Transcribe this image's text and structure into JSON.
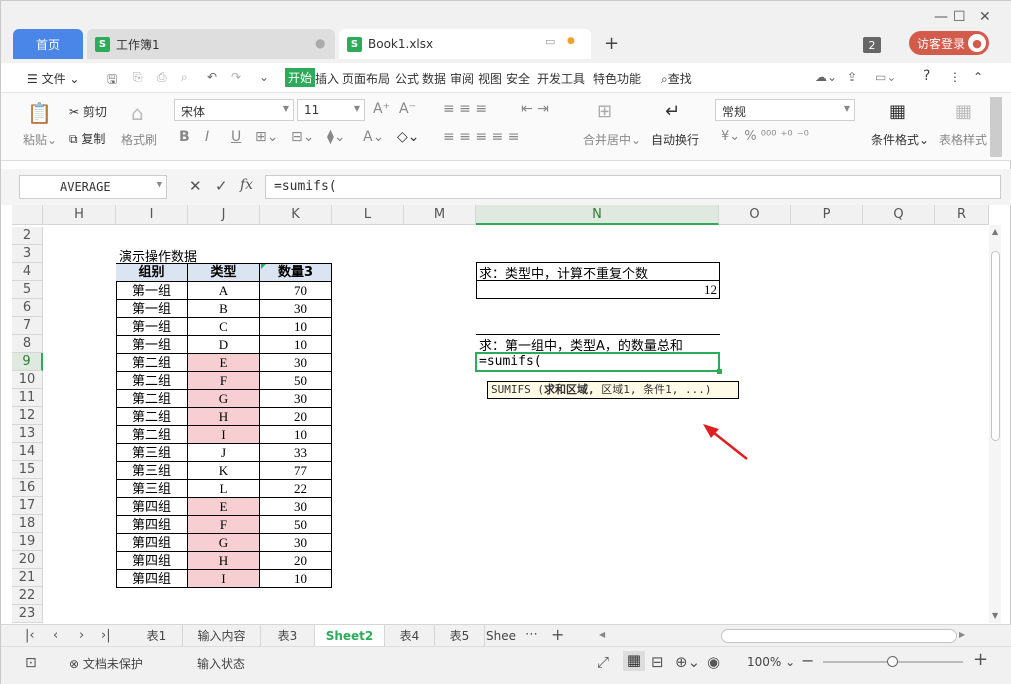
{
  "tabs": {
    "home": "首页",
    "book": "工作簿1",
    "xlsx": "Book1.xlsx",
    "badge": "2",
    "login": "访客登录"
  },
  "menu": {
    "file": "文件",
    "items": [
      "开始",
      "插入",
      "页面布局",
      "公式",
      "数据",
      "审阅",
      "视图",
      "安全",
      "开发工具",
      "特色功能"
    ],
    "search": "查找"
  },
  "ribbon": {
    "paste": "粘贴",
    "cut": "剪切",
    "copy": "复制",
    "format_painter": "格式刷",
    "font": "宋体",
    "size": "11",
    "merge": "合并居中",
    "wrap": "自动换行",
    "numfmt": "常规",
    "cond_format": "条件格式",
    "table_style": "表格样式"
  },
  "formula_bar": {
    "name_box": "AVERAGE",
    "fx": "fx",
    "formula": "=sumifs("
  },
  "columns": [
    "H",
    "I",
    "J",
    "K",
    "L",
    "M",
    "N",
    "O",
    "P",
    "Q",
    "R"
  ],
  "rows": [
    "2",
    "3",
    "4",
    "5",
    "6",
    "7",
    "8",
    "9",
    "10",
    "11",
    "12",
    "13",
    "14",
    "15",
    "16",
    "17",
    "18",
    "19",
    "20",
    "21",
    "22",
    "23"
  ],
  "table": {
    "title": "演示操作数据",
    "headers": [
      "组别",
      "类型",
      "数量3"
    ],
    "rows": [
      [
        "第一组",
        "A",
        "70"
      ],
      [
        "第一组",
        "B",
        "30"
      ],
      [
        "第一组",
        "C",
        "10"
      ],
      [
        "第一组",
        "D",
        "10"
      ],
      [
        "第二组",
        "E",
        "30"
      ],
      [
        "第二组",
        "F",
        "50"
      ],
      [
        "第二组",
        "G",
        "30"
      ],
      [
        "第二组",
        "H",
        "20"
      ],
      [
        "第二组",
        "I",
        "10"
      ],
      [
        "第三组",
        "J",
        "33"
      ],
      [
        "第三组",
        "K",
        "77"
      ],
      [
        "第三组",
        "L",
        "22"
      ],
      [
        "第四组",
        "E",
        "30"
      ],
      [
        "第四组",
        "F",
        "50"
      ],
      [
        "第四组",
        "G",
        "30"
      ],
      [
        "第四组",
        "H",
        "20"
      ],
      [
        "第四组",
        "I",
        "10"
      ]
    ],
    "pink_rows": [
      4,
      5,
      6,
      7,
      8,
      12,
      13,
      14,
      15,
      16
    ]
  },
  "question1": {
    "label": "求：类型中，计算不重复个数",
    "value": "12"
  },
  "question2": {
    "label": "求：第一组中，类型A，的数量总和",
    "input": "=sumifs("
  },
  "tooltip": {
    "fn": "SUMIFS (",
    "bold": "求和区域,",
    "rest": " 区域1, 条件1, ...)"
  },
  "sheets": [
    "表1",
    "输入内容",
    "表3",
    "Sheet2",
    "表4",
    "表5",
    "Shee"
  ],
  "active_sheet": "Sheet2",
  "status": {
    "protect": "文档未保护",
    "mode": "输入状态",
    "zoom": "100%"
  },
  "colors": {
    "accent": "#2eab5a",
    "header_fill": "#dbe4f1",
    "pink": "#f7cfd3",
    "home_tab": "#4a86e8",
    "arrow": "#e02020"
  }
}
